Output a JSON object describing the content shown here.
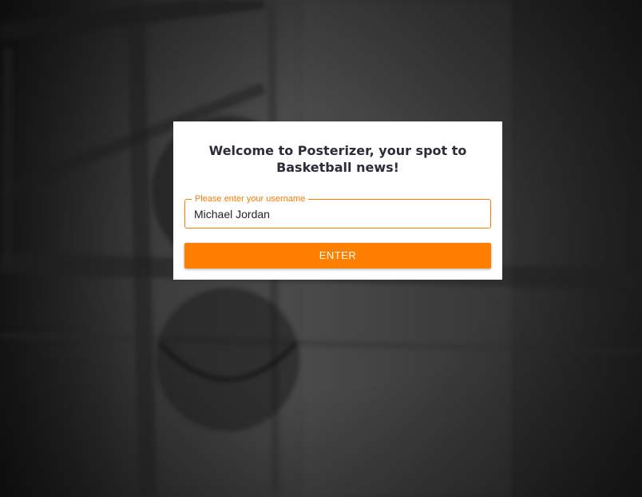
{
  "modal": {
    "title": "Welcome to Posterizer, your spot to Basketball news!",
    "username_label": "Please enter your username",
    "username_value": "Michael Jordan",
    "enter_label": "ENTER"
  },
  "colors": {
    "accent": "#ff8000",
    "field_border": "#f57c00",
    "title_text": "#2d2d3a",
    "background_dark": "#2b2b2b"
  }
}
